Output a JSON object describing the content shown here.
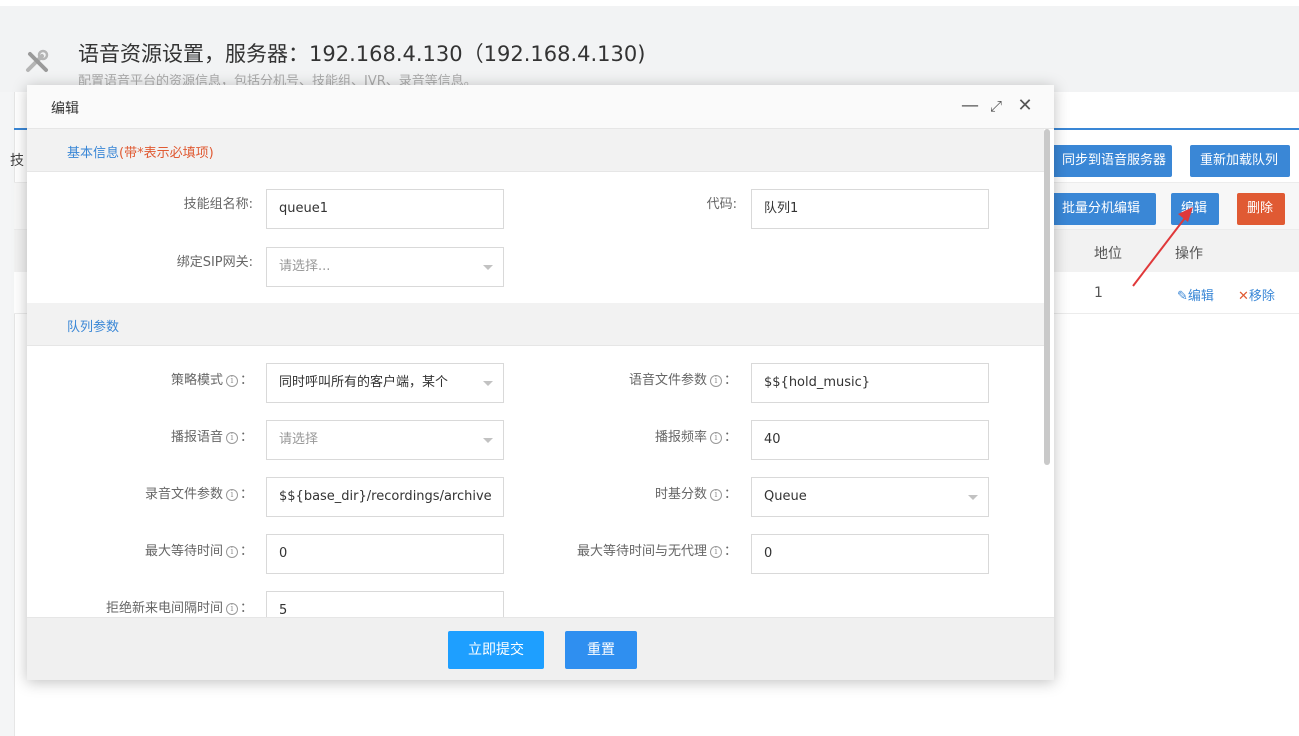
{
  "page": {
    "title": "语音资源设置，服务器：192.168.4.130（192.168.4.130)",
    "subtitle": "配置语音平台的资源信息，包括分机号、技能组、IVR、录音等信息。",
    "tab_fragment": "技",
    "icon": "tools-icon"
  },
  "toolbar": {
    "sync_label": "同步到语音服务器",
    "reload_label": "重新加载队列",
    "batch_edit_label": "批量分机编辑",
    "edit_label": "编辑",
    "delete_label": "删除"
  },
  "table": {
    "columns": [
      "地位",
      "操作"
    ],
    "rows": [
      {
        "position": "1",
        "edit_link": "编辑",
        "remove_link": "移除"
      }
    ]
  },
  "modal": {
    "title": "编辑",
    "controls": {
      "minimize": "—",
      "maximize": "⤢",
      "close": "✕"
    },
    "basic_section": {
      "title": "基本信息",
      "required_note": "(带*表示必填项)"
    },
    "queue_section": {
      "title": "队列参数"
    },
    "fields": {
      "skill_group_name": {
        "label": "技能组名称:",
        "value": "queue1"
      },
      "code": {
        "label": "代码:",
        "value": "队列1"
      },
      "sip_gateway": {
        "label": "绑定SIP网关:",
        "placeholder": "请选择..."
      },
      "strategy": {
        "label": "策略模式",
        "value": "同时呼叫所有的客户端，某个"
      },
      "voice_file_param": {
        "label": "语音文件参数",
        "value": "$${hold_music}"
      },
      "announce_voice": {
        "label": "播报语音",
        "placeholder": "请选择"
      },
      "announce_freq": {
        "label": "播报频率",
        "value": "40"
      },
      "record_file_param": {
        "label": "录音文件参数",
        "value": "$${base_dir}/recordings/archive"
      },
      "time_base_score": {
        "label": "时基分数",
        "value": "Queue"
      },
      "max_wait_time": {
        "label": "最大等待时间",
        "value": "0"
      },
      "max_wait_no_agent": {
        "label": "最大等待时间与无代理",
        "value": "0"
      },
      "reject_interval": {
        "label": "拒绝新来电间隔时间",
        "value": "5"
      }
    },
    "footer": {
      "submit_label": "立即提交",
      "reset_label": "重置"
    }
  },
  "colors": {
    "accent": "#3a87d6",
    "danger": "#e05a33",
    "primary_button": "#1e9fff",
    "annotation_arrow": "#e0383a"
  }
}
